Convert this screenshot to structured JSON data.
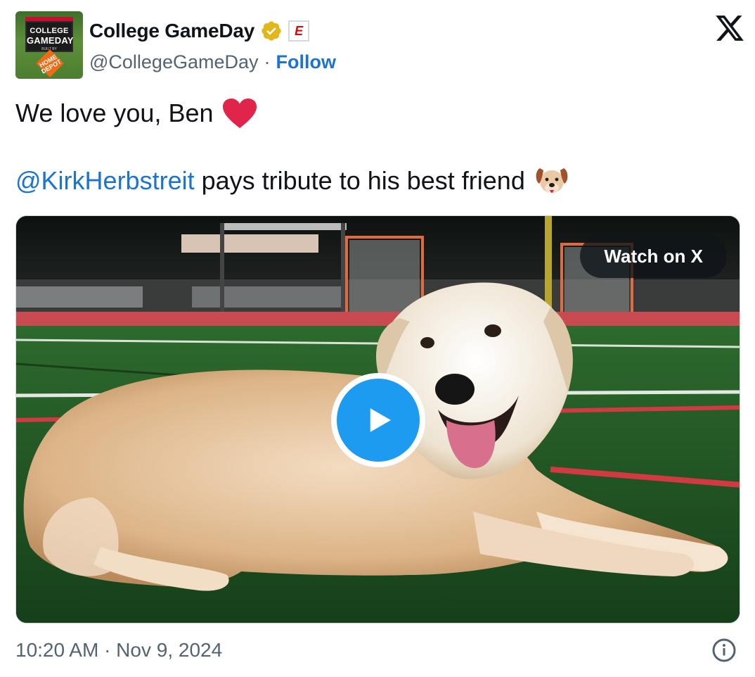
{
  "author": {
    "display_name": "College GameDay",
    "handle": "@CollegeGameDay",
    "separator": "·",
    "follow_label": "Follow",
    "avatar": {
      "line1": "COLLEGE",
      "line2": "GAMEDAY",
      "line3": "BUILT BY",
      "sign_text": "HOME DEPOT"
    },
    "affiliate_badge_letter": "E"
  },
  "tweet": {
    "line1": "We love you, Ben",
    "mention": "@KirkHerbstreit",
    "line2_rest": " pays tribute to his best friend"
  },
  "media": {
    "watch_label": "Watch on X"
  },
  "footer": {
    "timestamp": "10:20 AM · Nov 9, 2024"
  },
  "colors": {
    "link": "#1d74d0",
    "text": "#0f1419",
    "muted": "#536471",
    "play": "#1d9bf0",
    "verified": "#e2b719",
    "heart": "#e0244a"
  },
  "icons": {
    "verified": "verified-badge-icon",
    "x_logo": "x-logo-icon",
    "heart": "heart-emoji-icon",
    "dog": "dog-face-emoji-icon",
    "play": "play-icon",
    "info": "info-icon"
  }
}
